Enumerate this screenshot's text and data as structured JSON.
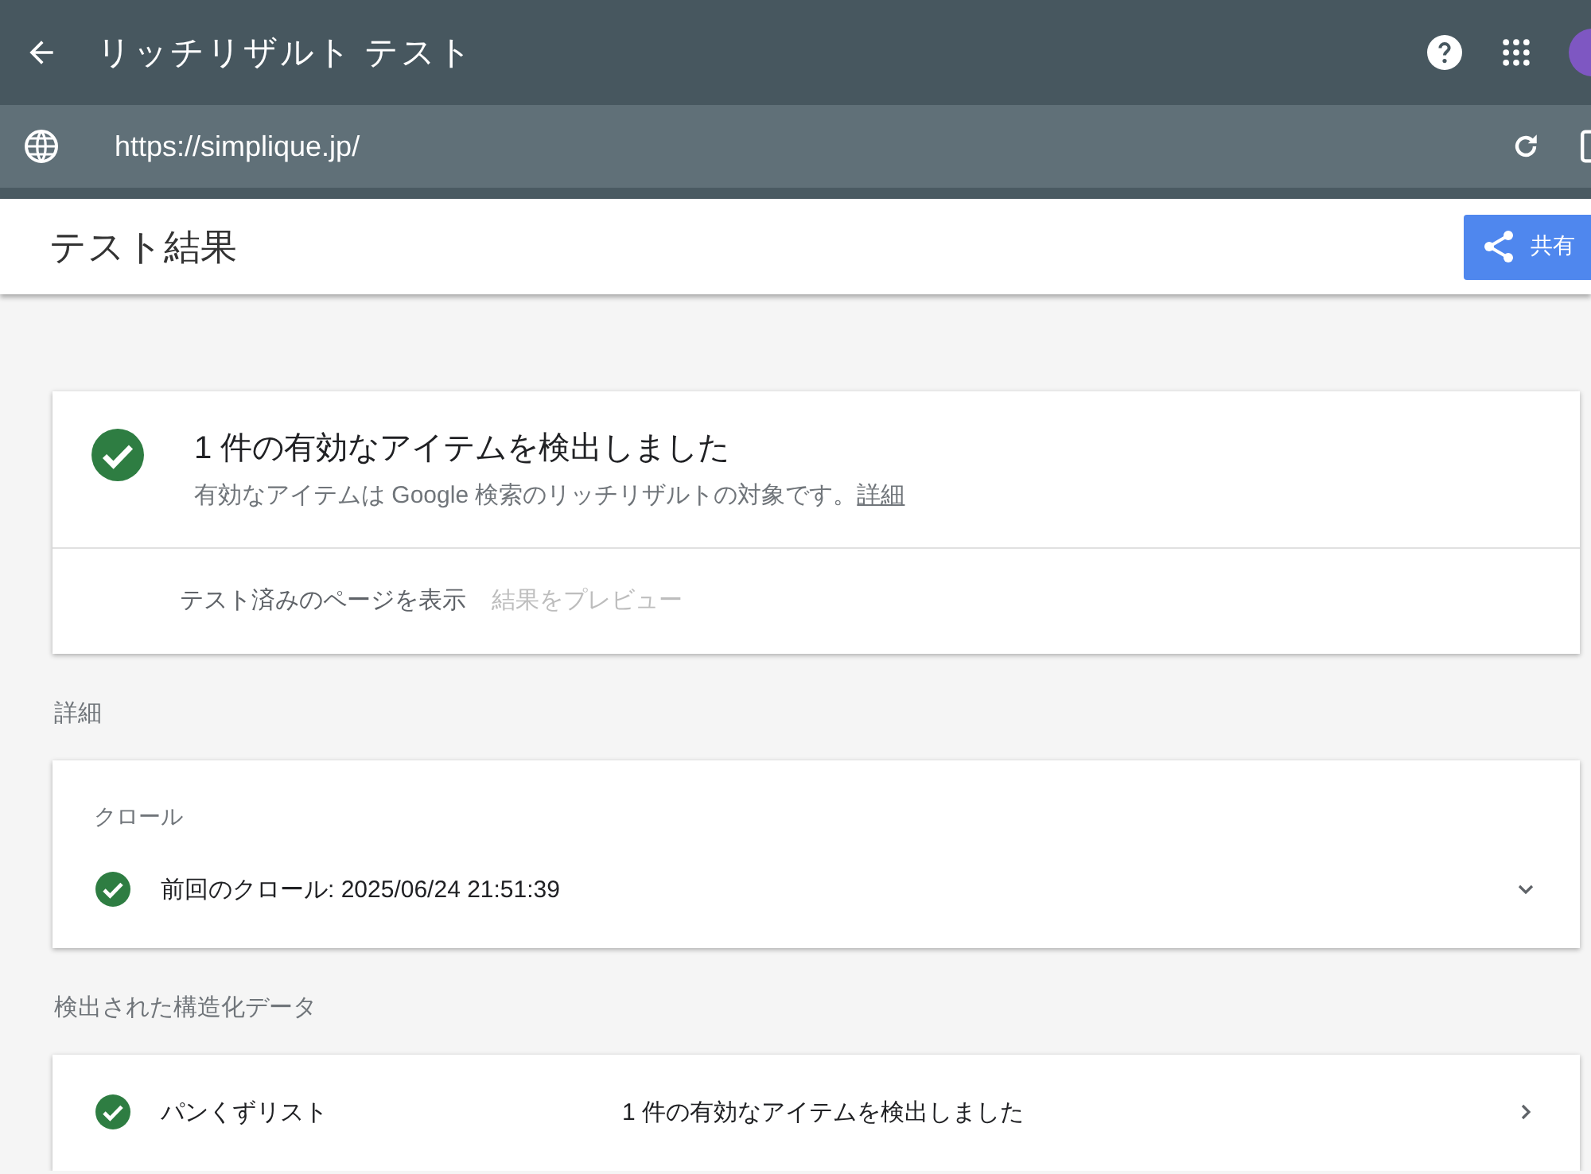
{
  "app_bar": {
    "title": "リッチリザルト テスト"
  },
  "url_bar": {
    "url": "https://simplique.jp/"
  },
  "header": {
    "title": "テスト結果",
    "share_label": "共有"
  },
  "summary": {
    "title": "1 件の有効なアイテムを検出しました",
    "description": "有効なアイテムは Google 検索のリッチリザルトの対象です。",
    "link": "詳細",
    "valid": true,
    "actions": [
      {
        "label": "テスト済みのページを表示",
        "disabled": false
      },
      {
        "label": "結果をプレビュー",
        "disabled": true
      }
    ]
  },
  "sections": [
    {
      "heading": "詳細",
      "card_title": "クロール",
      "rows": [
        {
          "label": "前回のクロール: 2025/06/24 21:51:39",
          "valid": true,
          "kind": "expand"
        }
      ]
    },
    {
      "heading": "検出された構造化データ",
      "rows": [
        {
          "label": "パンくずリスト",
          "status": "1 件の有効なアイテムを検出しました",
          "valid": true,
          "kind": "link"
        }
      ]
    }
  ]
}
